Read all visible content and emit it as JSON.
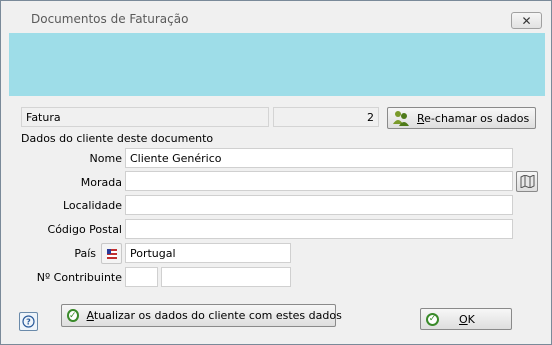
{
  "window": {
    "title": "Documentos de Faturação",
    "close_glyph": "✕"
  },
  "doc": {
    "type": "Fatura",
    "number": "2"
  },
  "buttons": {
    "recall_first": "R",
    "recall_rest": "e-chamar os dados",
    "update_first": "A",
    "update_rest": "tualizar os dados do cliente com estes dados",
    "ok_first": "O",
    "ok_rest": "K"
  },
  "section": {
    "title": "Dados do cliente deste documento"
  },
  "labels": {
    "nome": "Nome",
    "morada": "Morada",
    "localidade": "Localidade",
    "codigo_postal": "Código Postal",
    "pais": "País",
    "contribuinte": "Nº Contribuinte"
  },
  "values": {
    "nome": "Cliente Genérico",
    "morada": "",
    "localidade": "",
    "codigo_postal": "",
    "pais": "Portugal",
    "contribuinte_prefix": "",
    "contribuinte": ""
  },
  "icons": {
    "users": "users-icon",
    "map": "map-icon",
    "flag": "flag-icon",
    "help": "help-icon",
    "check": "check-icon"
  },
  "colors": {
    "banner": "#9edde8",
    "check_green": "#3a8a2a"
  }
}
